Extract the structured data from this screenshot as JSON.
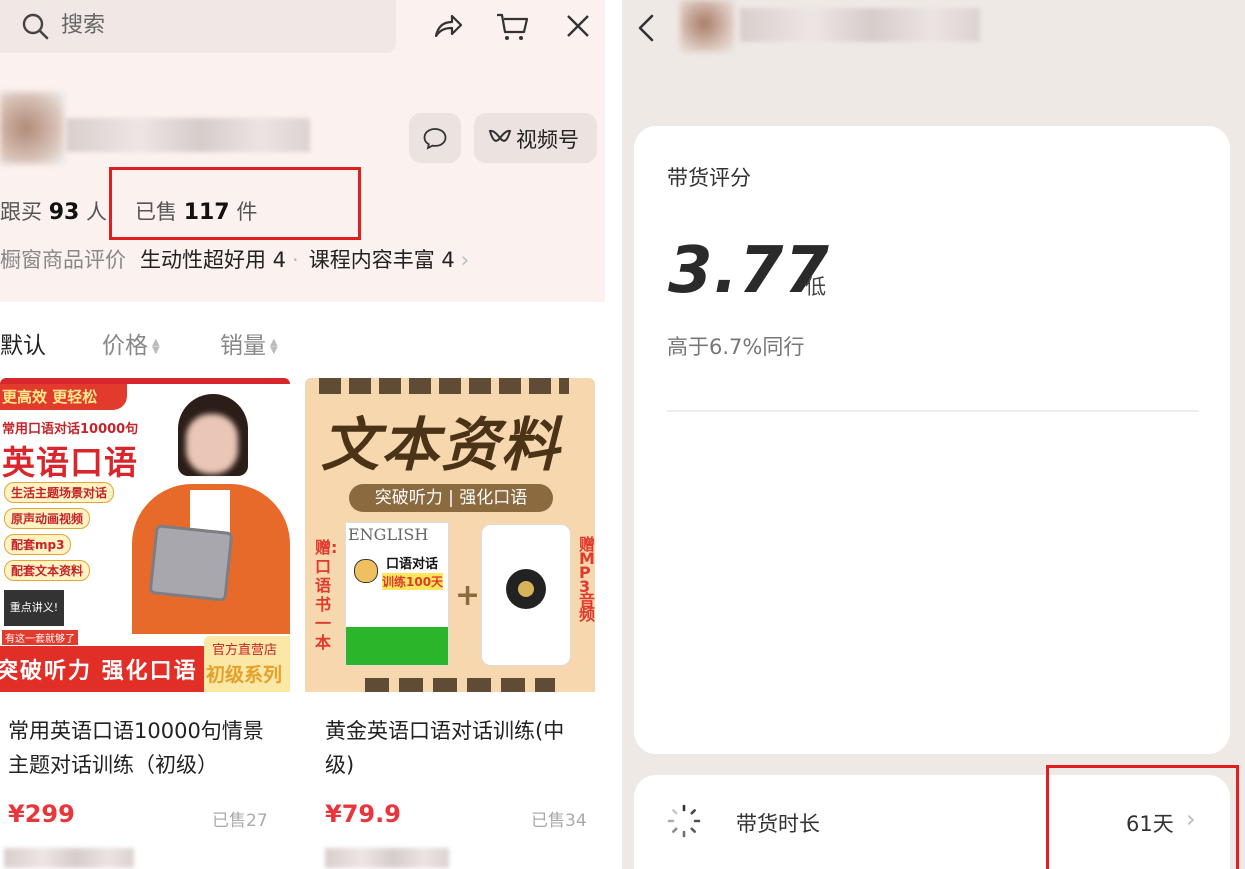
{
  "left": {
    "search": {
      "placeholder": "搜索"
    },
    "shop": {
      "channel_button": "视频号",
      "followers_label": "跟买",
      "followers_count": "93",
      "followers_unit": "人",
      "sold_label": "已售",
      "sold_count": "117",
      "sold_unit": "件"
    },
    "review": {
      "label": "橱窗商品评价",
      "items": [
        "生动性超好用 4",
        "课程内容丰富 4"
      ],
      "more": "›"
    },
    "sort": {
      "tabs": [
        "默认",
        "价格",
        "销量"
      ],
      "active": "默认"
    },
    "products": [
      {
        "title": "常用英语口语10000句情景主题对话训练（初级）",
        "price": "¥299",
        "sold": "已售27",
        "image": {
          "banner": "更高效 更轻松",
          "subtitle": "常用口语对话10000句",
          "headline": "英语口语",
          "tags": [
            "生活主题场景对话",
            "原声动画视频",
            "配套mp3",
            "配套文本资料"
          ],
          "badge": "重点讲义!",
          "note": "有这一套就够了",
          "footer": "突破听力 强化口语",
          "store": "官方直营店",
          "series": "初级系列"
        }
      },
      {
        "title": "黄金英语口语对话训练(中级)",
        "price": "¥79.9",
        "sold": "已售34",
        "image": {
          "headline": "文本资料",
          "ribbon": "突破听力 | 强化口语",
          "left_side": "赠:口语书一本",
          "right_side": "赠:MP3音频",
          "book_top": "ENGLISH",
          "book_title": "口语对话",
          "book_sub": "训练100天",
          "plus": "+"
        }
      }
    ]
  },
  "right": {
    "score": {
      "title": "带货评分",
      "value": "3.77",
      "level": "低",
      "compare": "高于6.7%同行"
    },
    "duration": {
      "label": "带货时长",
      "value": "61天",
      "chevron": "›"
    }
  },
  "colors": {
    "accent_red": "#e8363c",
    "highlight_box": "#e02020",
    "header_bg": "#fbf1ee",
    "right_bg": "#efe9e6"
  }
}
